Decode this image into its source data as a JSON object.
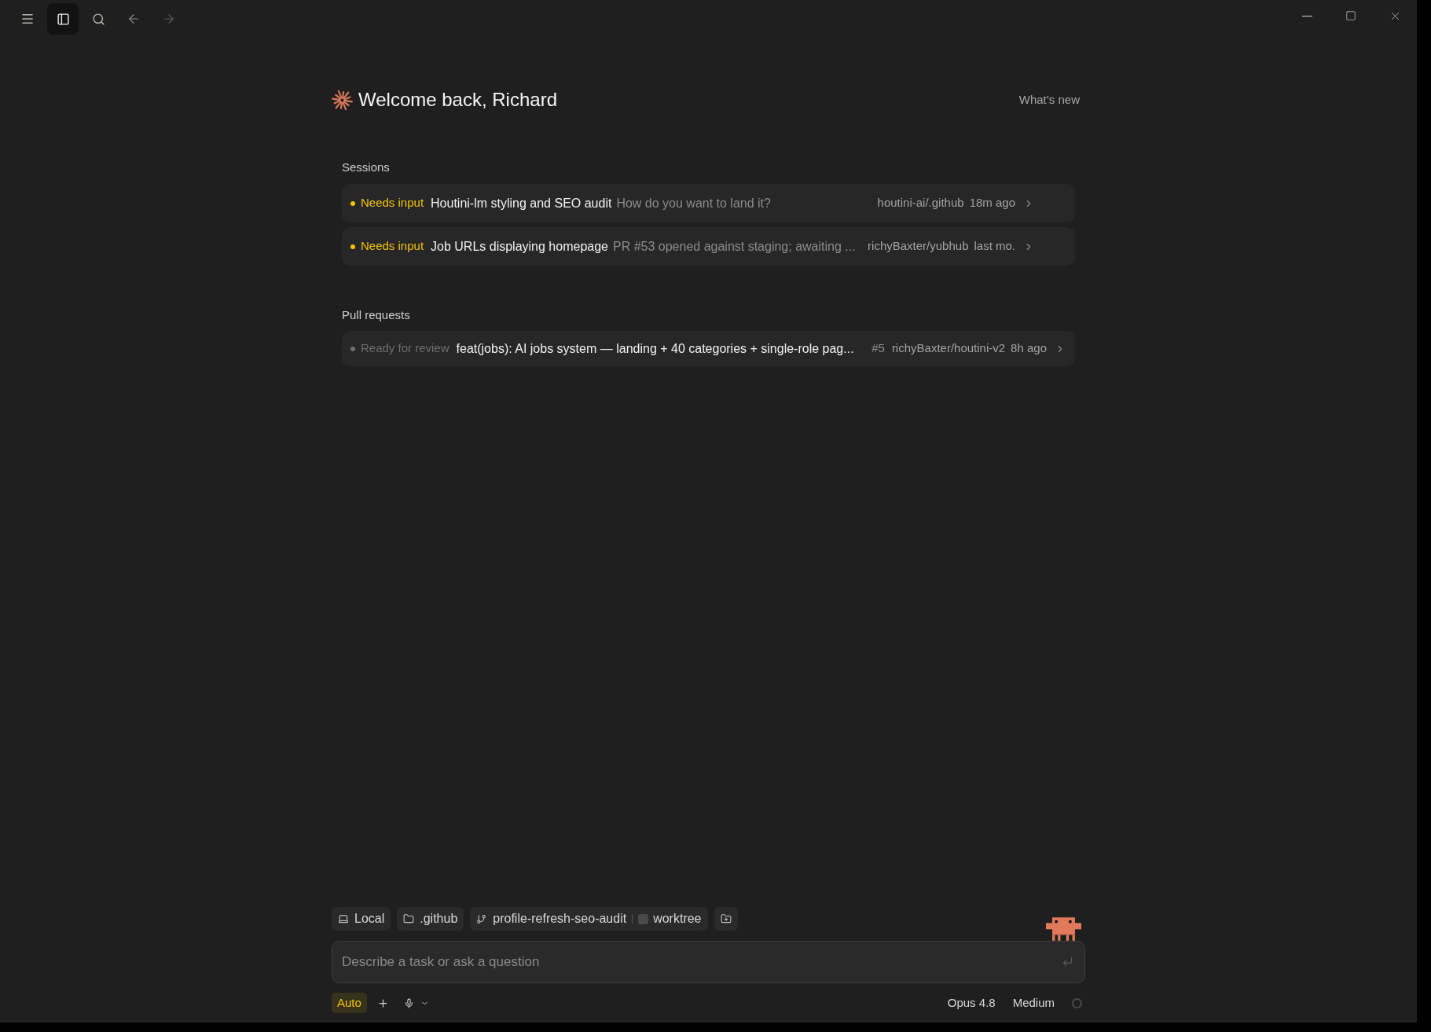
{
  "toolbar": {
    "sidebar_toggle": {
      "selected": true
    },
    "back": {
      "disabled": false
    },
    "forward": {
      "disabled": true
    }
  },
  "header": {
    "title": "Welcome back, Richard",
    "link": "What’s new"
  },
  "sessions": {
    "heading": "Sessions",
    "items": [
      {
        "status": "Needs input",
        "color": "#f5c400",
        "title": "Houtini-lm styling and SEO audit",
        "message": "How do you want to land it?",
        "repo": "houtini-ai/.github",
        "time": "18m ago"
      },
      {
        "status": "Needs input",
        "color": "#f5c400",
        "title": "Job URLs displaying homepage",
        "message": "PR #53 opened against staging; awaiting ...",
        "repo": "richyBaxter/yubhub",
        "time": "last mo."
      }
    ]
  },
  "pull_requests": {
    "heading": "Pull requests",
    "items": [
      {
        "status": "Ready for review",
        "color": "#6e6e6e",
        "title": "feat(jobs): AI jobs system — landing + 40 categories + single-role pag...",
        "number": "#5",
        "repo": "richyBaxter/houtini-v2",
        "time": "8h ago"
      }
    ]
  },
  "composer": {
    "chips": [
      {
        "kind": "environment",
        "label": "Local"
      },
      {
        "kind": "folder",
        "label": ".github"
      },
      {
        "kind": "branch",
        "label": "profile-refresh-seo-audit",
        "worktree": {
          "label": "worktree",
          "checked": false
        }
      },
      {
        "kind": "add_folder"
      }
    ],
    "placeholder": "Describe a task or ask a question",
    "mode": "Auto",
    "model": "Opus 4.8",
    "effort": "Medium"
  }
}
